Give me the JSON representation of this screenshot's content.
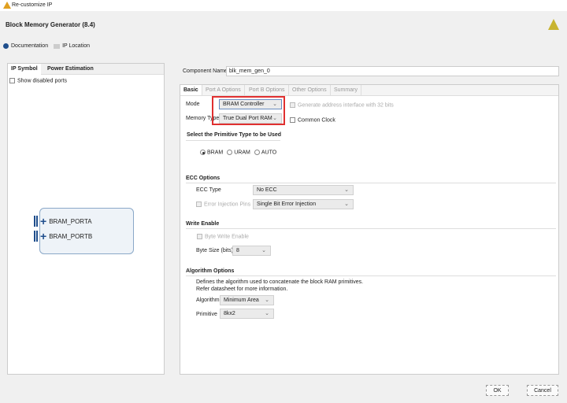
{
  "window": {
    "title": "Re-customize IP"
  },
  "header": {
    "title": "Block Memory Generator (8.4)",
    "documentation": "Documentation",
    "ip_location": "IP Location"
  },
  "left": {
    "tabs": [
      "IP Symbol",
      "Power Estimation"
    ],
    "show_disabled_ports": "Show disabled ports",
    "ports": [
      "BRAM_PORTA",
      "BRAM_PORTB"
    ]
  },
  "component": {
    "label": "Component Name",
    "value": "blk_mem_gen_0"
  },
  "tabs": [
    "Basic",
    "Port A Options",
    "Port B Options",
    "Other Options",
    "Summary"
  ],
  "basic": {
    "mode_label": "Mode",
    "mode_value": "BRAM Controller",
    "memtype_label": "Memory Type",
    "memtype_value": "True Dual Port RAM",
    "gen_addr": "Generate address interface with 32 bits",
    "common_clock": "Common Clock",
    "primitive_title": "Select the Primitive Type to be Used",
    "primitive_options": [
      "BRAM",
      "URAM",
      "AUTO"
    ],
    "ecc_title": "ECC Options",
    "ecc_type_label": "ECC Type",
    "ecc_type_value": "No ECC",
    "err_inj_label": "Error Injection Pins",
    "err_inj_value": "Single Bit Error Injection",
    "we_title": "Write Enable",
    "byte_write": "Byte Write Enable",
    "byte_size_label": "Byte Size (bits)",
    "byte_size_value": "8",
    "algo_title": "Algorithm Options",
    "algo_desc1": "Defines the algorithm used to concatenate the block RAM primitives.",
    "algo_desc2": "Refer datasheet for more information.",
    "algo_label": "Algorithm",
    "algo_value": "Minimum Area",
    "prim_label": "Primitive",
    "prim_value": "8kx2"
  },
  "buttons": {
    "ok": "OK",
    "cancel": "Cancel"
  },
  "colors": {
    "highlight": "#e03030",
    "accent": "#1f4e8c"
  }
}
